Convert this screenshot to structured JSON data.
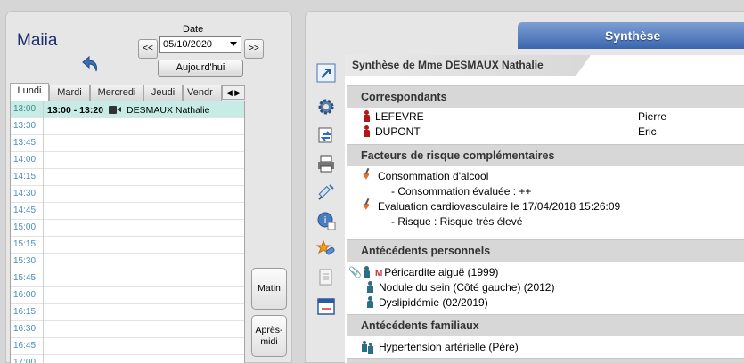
{
  "agenda": {
    "app_name": "Maiia",
    "date_label": "Date",
    "prev_label": "<<",
    "next_label": ">>",
    "selected_date": "05/10/2020",
    "today_label": "Aujourd'hui",
    "tabs": [
      "Lundi",
      "Mardi",
      "Mercredi",
      "Jeudi",
      "Vendr"
    ],
    "active_tab": "Lundi",
    "slots": [
      "13:00",
      "13:30",
      "13:45",
      "14:00",
      "14:15",
      "14:30",
      "14:45",
      "15:00",
      "15:15",
      "15:30",
      "15:45",
      "16:00",
      "16:15",
      "16:30",
      "16:45",
      "17:00"
    ],
    "appointment": {
      "time_range": "13:00 - 13:20",
      "patient": "DESMAUX Nathalie"
    },
    "matin_label": "Matin",
    "apres_midi_label": "Après-midi"
  },
  "synthese": {
    "tab_label": "Synthèse",
    "patient_title": "Synthèse de Mme DESMAUX Nathalie",
    "sections": {
      "correspondants": {
        "title": "Correspondants",
        "rows": [
          {
            "name": "LEFEVRE",
            "firstname": "Pierre"
          },
          {
            "name": "DUPONT",
            "firstname": "Eric"
          }
        ]
      },
      "facteurs": {
        "title": "Facteurs de risque complémentaires",
        "items": [
          "Consommation d'alcool",
          "- Consommation évaluée : ++",
          "Evaluation cardiovasculaire le 17/04/2018 15:26:09",
          "- Risque : Risque très élevé"
        ]
      },
      "antecedents_personnels": {
        "title": "Antécédents personnels",
        "items": [
          "Péricardite aiguë  (1999)",
          "Nodule du sein (Côté gauche)  (2012)",
          "Dyslipidémie  (02/2019)"
        ]
      },
      "antecedents_familiaux": {
        "title": "Antécédents familiaux",
        "items": [
          "Hypertension artérielle (Père)"
        ]
      }
    }
  },
  "colors": {
    "accent_blue": "#3b66ad",
    "slot_highlight": "#c7ece6",
    "section_header": "#d7d7d7"
  }
}
